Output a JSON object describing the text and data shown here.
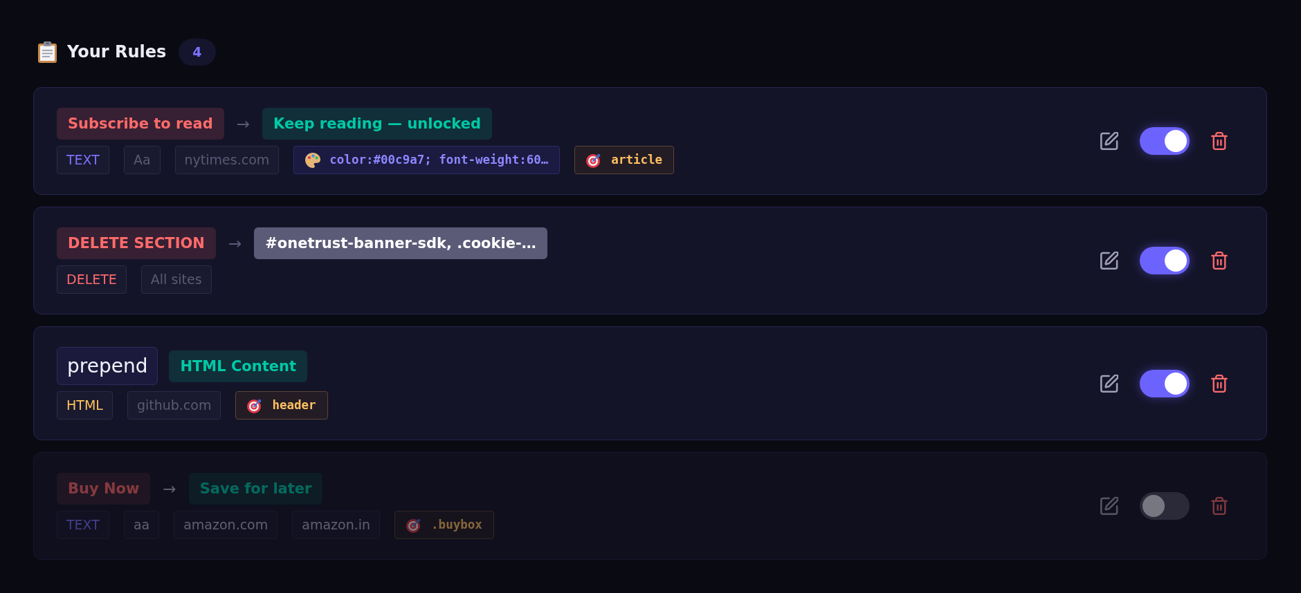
{
  "header": {
    "title": "Your Rules",
    "count": "4"
  },
  "rules": [
    {
      "enabled": true,
      "head": [
        {
          "kind": "find",
          "text": "Subscribe to read"
        },
        {
          "kind": "arrow",
          "text": "→"
        },
        {
          "kind": "replace",
          "text": "Keep reading — unlocked"
        }
      ],
      "tags": [
        {
          "kind": "text",
          "text": "TEXT"
        },
        {
          "kind": "case",
          "text": "Aa"
        },
        {
          "kind": "site",
          "text": "nytimes.com"
        },
        {
          "kind": "style",
          "text": "color:#00c9a7; font-weight:60…"
        },
        {
          "kind": "target",
          "text": "article"
        }
      ]
    },
    {
      "enabled": true,
      "head": [
        {
          "kind": "find",
          "text": "DELETE SECTION"
        },
        {
          "kind": "arrow",
          "text": "→"
        },
        {
          "kind": "selector",
          "text": "#onetrust-banner-sdk, .cookie-…"
        }
      ],
      "tags": [
        {
          "kind": "delete",
          "text": "DELETE"
        },
        {
          "kind": "site",
          "text": "All sites"
        }
      ]
    },
    {
      "enabled": true,
      "head": [
        {
          "kind": "position",
          "text": "prepend"
        },
        {
          "kind": "replace",
          "text": "HTML Content"
        }
      ],
      "tags": [
        {
          "kind": "html",
          "text": "HTML"
        },
        {
          "kind": "site",
          "text": "github.com"
        },
        {
          "kind": "target",
          "text": "header"
        }
      ]
    },
    {
      "enabled": false,
      "head": [
        {
          "kind": "find",
          "text": "Buy Now"
        },
        {
          "kind": "arrow",
          "text": "→"
        },
        {
          "kind": "replace",
          "text": "Save for later"
        }
      ],
      "tags": [
        {
          "kind": "text",
          "text": "TEXT"
        },
        {
          "kind": "case",
          "text": "aa"
        },
        {
          "kind": "site",
          "text": "amazon.com"
        },
        {
          "kind": "site",
          "text": "amazon.in"
        },
        {
          "kind": "target",
          "text": ".buybox"
        }
      ]
    }
  ]
}
